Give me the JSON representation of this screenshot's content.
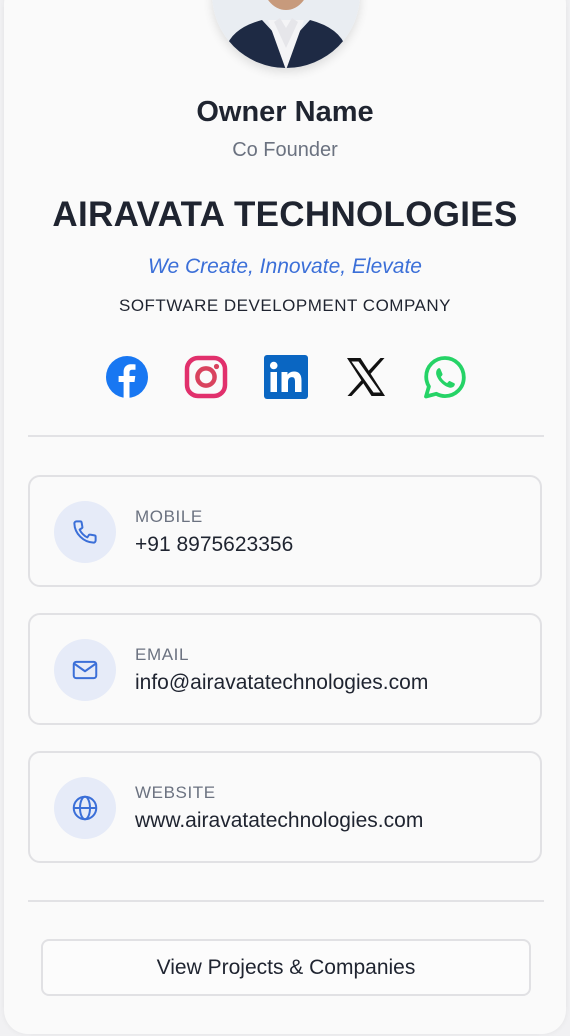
{
  "profile": {
    "name": "Owner Name",
    "role": "Co Founder",
    "company": "AIRAVATA TECHNOLOGIES",
    "tagline": "We Create, Innovate, Elevate",
    "company_type": "SOFTWARE DEVELOPMENT COMPANY"
  },
  "social": [
    {
      "icon": "facebook-icon",
      "color": "#1877f2"
    },
    {
      "icon": "instagram-icon",
      "color": "#e1306c"
    },
    {
      "icon": "linkedin-icon",
      "color": "#0a66c2"
    },
    {
      "icon": "x-icon",
      "color": "#111111"
    },
    {
      "icon": "whatsapp-icon",
      "color": "#25d366"
    }
  ],
  "contacts": {
    "mobile": {
      "label": "MOBILE",
      "value": "+91 8975623356",
      "icon": "phone-icon"
    },
    "email": {
      "label": "EMAIL",
      "value": "info@airavatatechnologies.com",
      "icon": "mail-icon"
    },
    "website": {
      "label": "WEBSITE",
      "value": "www.airavatatechnologies.com",
      "icon": "globe-icon"
    }
  },
  "actions": {
    "view_projects_label": "View Projects & Companies"
  },
  "colors": {
    "accent": "#3b6fd8",
    "icon_bg": "#e6ebf8",
    "text": "#1f2430",
    "muted": "#6b7280"
  }
}
